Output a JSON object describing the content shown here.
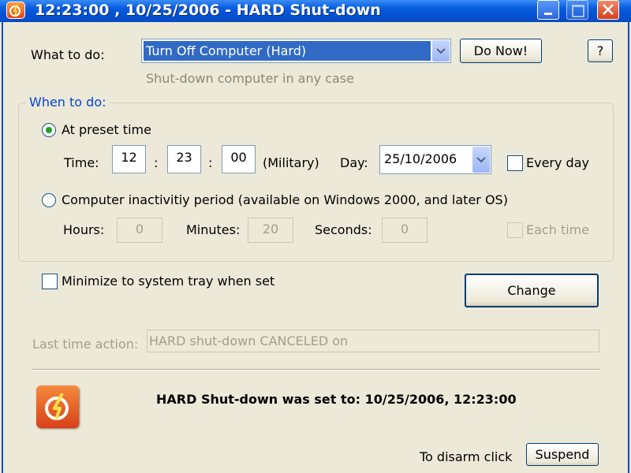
{
  "window": {
    "title": "12:23:00 , 10/25/2006 - HARD Shut-down"
  },
  "what_to_do": {
    "label": "What to do:",
    "selected": "Turn Off Computer (Hard)",
    "description": "Shut-down computer in any case",
    "do_now_label": "Do Now!",
    "help_label": "?"
  },
  "when_to_do": {
    "group_label": "When to do:",
    "preset_time_label": "At preset time",
    "preset_time_selected": true,
    "time_label": "Time:",
    "hour": "12",
    "minute": "23",
    "second": "00",
    "separator": ":",
    "military_label": "(Military)",
    "day_label": "Day:",
    "day_value": "25/10/2006",
    "every_day_label": "Every day",
    "every_day_checked": false,
    "inactivity_label": "Computer inactivitiy period (available on Windows 2000, and later OS)",
    "inactivity_selected": false,
    "hours_label": "Hours:",
    "hours_value": "0",
    "minutes_label": "Minutes:",
    "minutes_value": "20",
    "seconds_label": "Seconds:",
    "seconds_value": "0",
    "each_time_label": "Each time",
    "each_time_checked": false
  },
  "options": {
    "minimize_label": "Minimize to system tray when set",
    "minimize_checked": false,
    "change_label": "Change"
  },
  "last_action": {
    "label": "Last time action:",
    "value": "HARD shut-down CANCELED on"
  },
  "status": {
    "message": "HARD Shut-down was set to: 10/25/2006, 12:23:00",
    "disarm_label": "To disarm click",
    "suspend_label": "Suspend"
  },
  "colors": {
    "titlebar": "#0a5fe0",
    "window_bg": "#ece9d8",
    "selection": "#316ac5",
    "group_title": "#0046d5",
    "icon_orange": "#e2461a"
  }
}
